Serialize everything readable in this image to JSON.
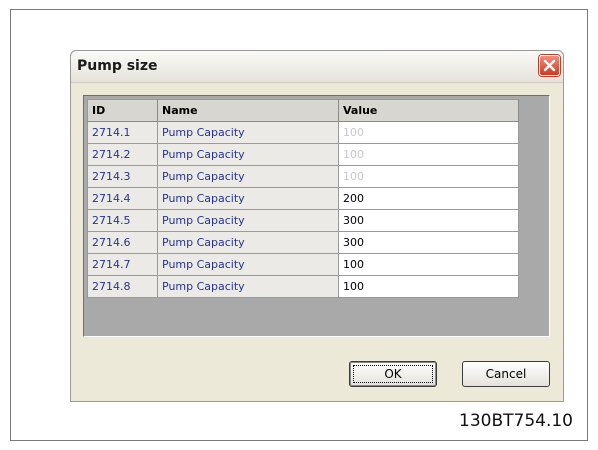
{
  "dialog": {
    "title": "Pump size",
    "close_icon": "close-icon",
    "accent_close": "#d94a30"
  },
  "grid": {
    "headers": [
      "ID",
      "Name",
      "Value"
    ],
    "rows": [
      {
        "id": "2714.1",
        "name": "Pump Capacity",
        "value": "100",
        "disabled": true
      },
      {
        "id": "2714.2",
        "name": "Pump Capacity",
        "value": "100",
        "disabled": true
      },
      {
        "id": "2714.3",
        "name": "Pump Capacity",
        "value": "100",
        "disabled": true
      },
      {
        "id": "2714.4",
        "name": "Pump Capacity",
        "value": "200",
        "disabled": false
      },
      {
        "id": "2714.5",
        "name": "Pump Capacity",
        "value": "300",
        "disabled": false
      },
      {
        "id": "2714.6",
        "name": "Pump Capacity",
        "value": "300",
        "disabled": false
      },
      {
        "id": "2714.7",
        "name": "Pump Capacity",
        "value": "100",
        "disabled": false
      },
      {
        "id": "2714.8",
        "name": "Pump Capacity",
        "value": "100",
        "disabled": false
      }
    ]
  },
  "buttons": {
    "ok_label": "OK",
    "cancel_label": "Cancel"
  },
  "figure_id": "130BT754.10"
}
